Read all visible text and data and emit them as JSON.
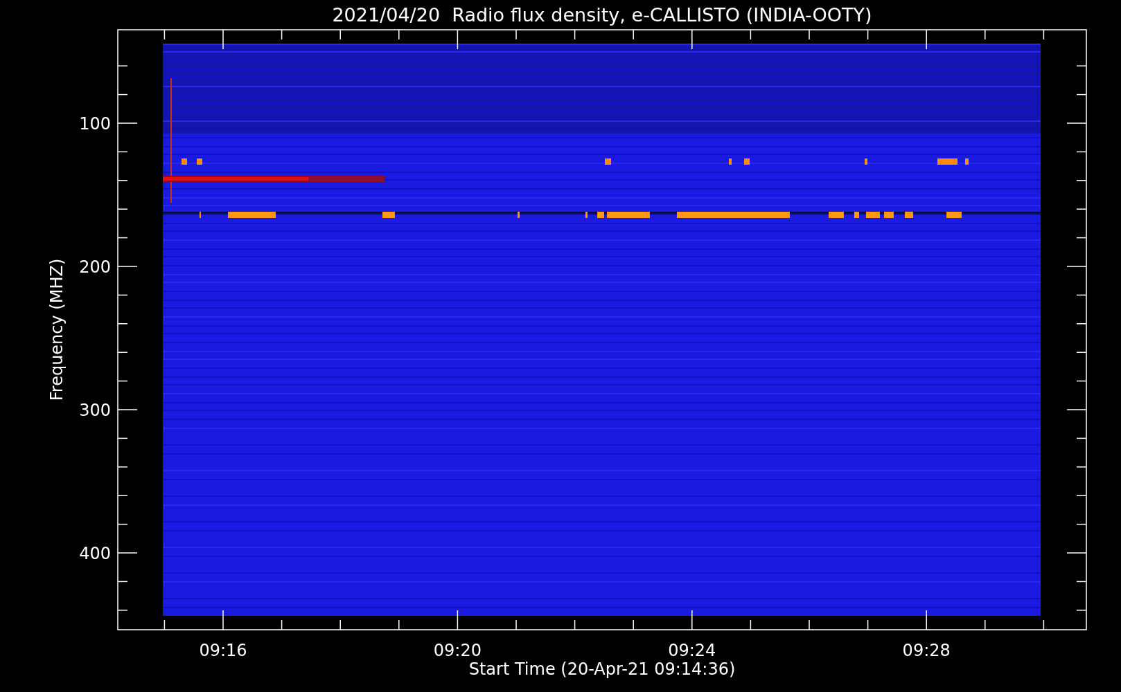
{
  "title": "2021/04/20  Radio flux density, e-CALLISTO (INDIA-OOTY)",
  "ylabel": "Frequency (MHZ)",
  "yticks": [
    "100",
    "200",
    "300",
    "400"
  ],
  "xticks": [
    "09:16",
    "09:20",
    "09:24",
    "09:28"
  ],
  "xlabel": "Start Time (20-Apr-21 09:14:36)"
}
